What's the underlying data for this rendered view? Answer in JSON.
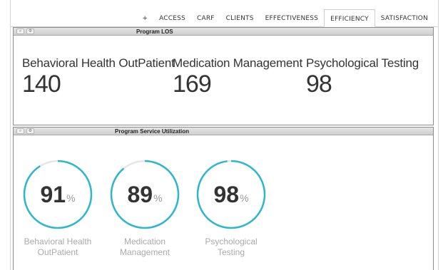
{
  "tabs": [
    {
      "label": "+",
      "active": false
    },
    {
      "label": "ACCESS",
      "active": false
    },
    {
      "label": "CARF",
      "active": false
    },
    {
      "label": "CLIENTS",
      "active": false
    },
    {
      "label": "EFFECTIVENESS",
      "active": false
    },
    {
      "label": "EFFICIENCY",
      "active": true
    },
    {
      "label": "SATISFACTION",
      "active": false
    }
  ],
  "panel_los": {
    "title": "Program LOS",
    "items": [
      {
        "label": "Behavioral Health OutPatient",
        "value": "140"
      },
      {
        "label": "Medication Management",
        "value": "169"
      },
      {
        "label": "Psychological Testing",
        "value": "98"
      }
    ]
  },
  "panel_util": {
    "title": "Program Service Utilization",
    "unit": "%",
    "gauges": [
      {
        "value": 91,
        "line1": "Behavioral Health",
        "line2": "OutPatient"
      },
      {
        "value": 89,
        "line1": "Medication",
        "line2": "Management"
      },
      {
        "value": 98,
        "line1": "Psychological",
        "line2": "Testing"
      }
    ]
  },
  "colors": {
    "gauge_fill": "#2bb7cf",
    "gauge_track": "#e6e6e6"
  }
}
